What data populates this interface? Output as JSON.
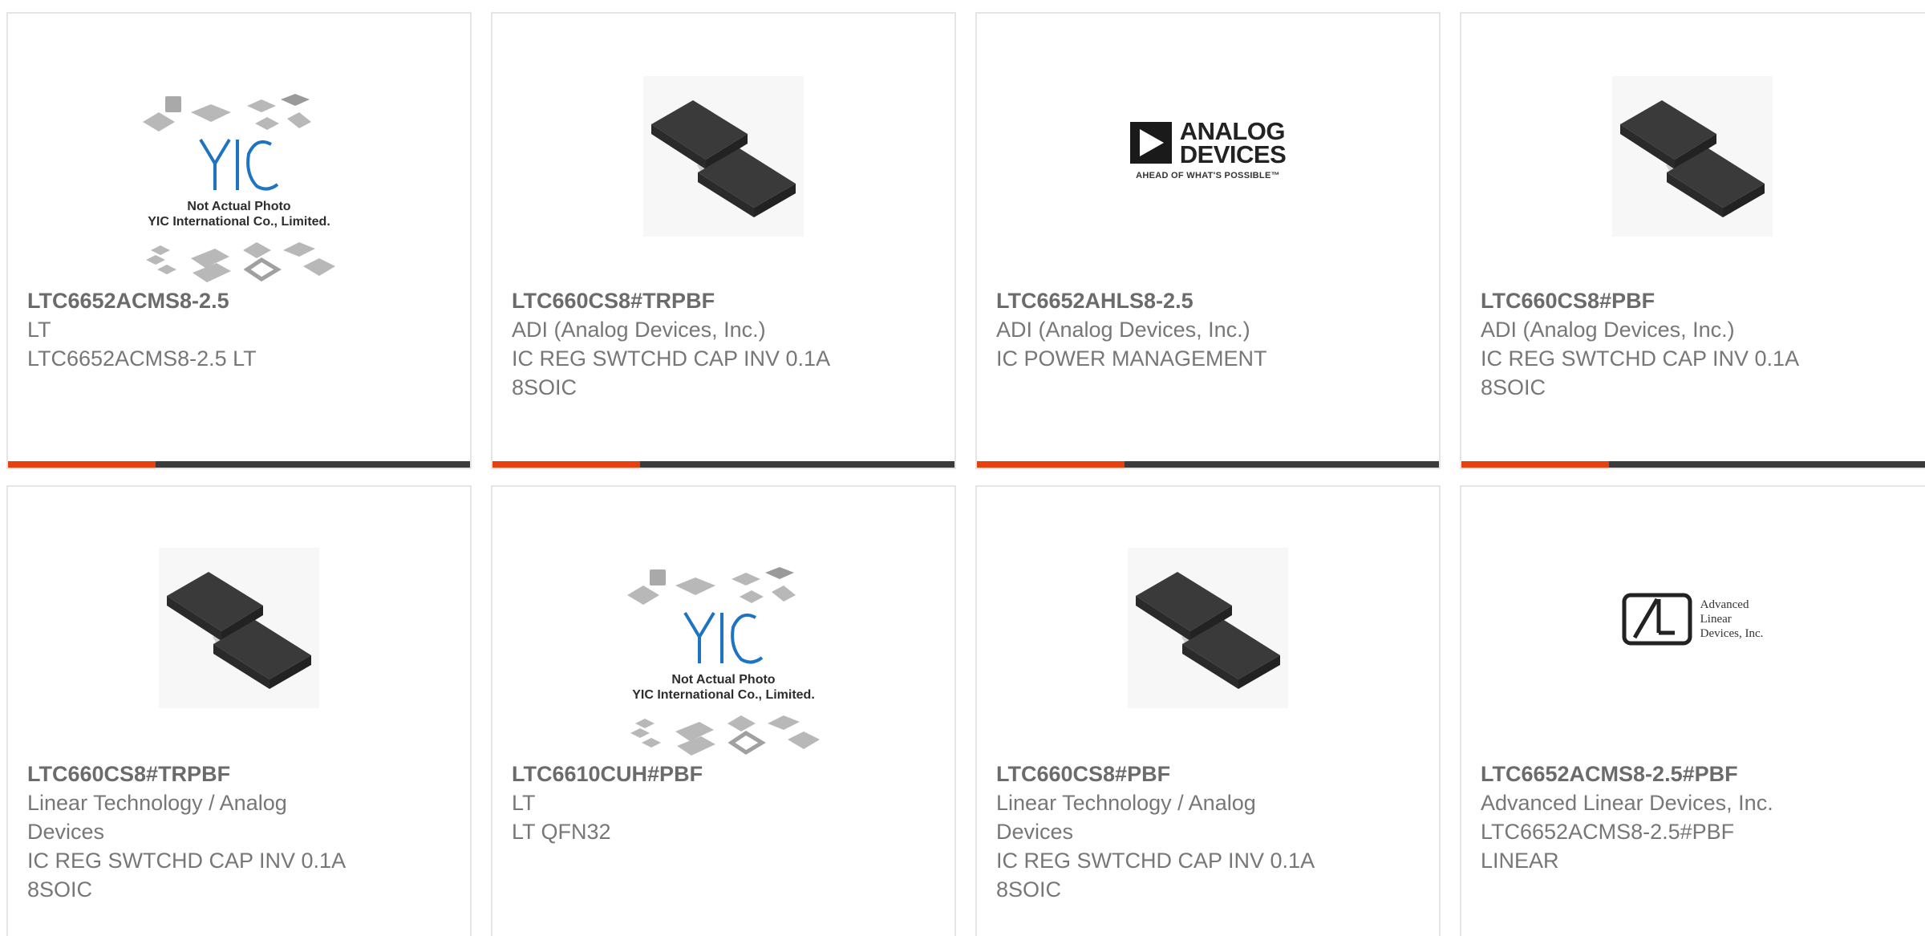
{
  "products": [
    {
      "part_number": "LTC6652ACMS8-2.5",
      "manufacturer": "LT",
      "description": "LTC6652ACMS8-2.5 LT",
      "image": "yic-placeholder",
      "placeholder_text": [
        "Not Actual Photo",
        "YIC International Co., Limited."
      ]
    },
    {
      "part_number": "LTC660CS8#TRPBF",
      "manufacturer": "ADI (Analog Devices, Inc.)",
      "description": "IC REG SWTCHD CAP INV 0.1A 8SOIC",
      "image": "soic8-chip-photo"
    },
    {
      "part_number": "LTC6652AHLS8-2.5",
      "manufacturer": "ADI (Analog Devices, Inc.)",
      "description": "IC POWER MANAGEMENT",
      "image": "analog-devices-logo",
      "logo_text": [
        "ANALOG",
        "DEVICES"
      ],
      "logo_tagline": "AHEAD OF WHAT'S POSSIBLE™"
    },
    {
      "part_number": "LTC660CS8#PBF",
      "manufacturer": "ADI (Analog Devices, Inc.)",
      "description": "IC REG SWTCHD CAP INV 0.1A 8SOIC",
      "image": "soic8-chip-photo"
    },
    {
      "part_number": "LTC660CS8#TRPBF",
      "manufacturer": "Linear Technology / Analog Devices",
      "description": "IC REG SWTCHD CAP INV 0.1A 8SOIC",
      "image": "soic8-chip-photo"
    },
    {
      "part_number": "LTC6610CUH#PBF",
      "manufacturer": "LT",
      "description": "LT QFN32",
      "image": "yic-placeholder",
      "placeholder_text": [
        "Not Actual Photo",
        "YIC International Co., Limited."
      ]
    },
    {
      "part_number": "LTC660CS8#PBF",
      "manufacturer": "Linear Technology / Analog Devices",
      "description": "IC REG SWTCHD CAP INV 0.1A 8SOIC",
      "image": "soic8-chip-photo"
    },
    {
      "part_number": "LTC6652ACMS8-2.5#PBF",
      "manufacturer": "Advanced Linear Devices, Inc.",
      "description": "LTC6652ACMS8-2.5#PBF LINEAR",
      "image": "advanced-linear-devices-logo",
      "logo_text": [
        "Advanced",
        "Linear",
        "Devices, Inc."
      ]
    }
  ],
  "colors": {
    "accent": "#e8400e",
    "bar": "#3b3b3b",
    "border": "#e5e5e5",
    "yic_blue": "#1e74c2"
  }
}
